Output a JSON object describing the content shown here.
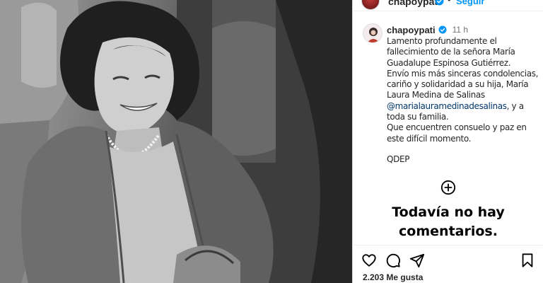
{
  "header": {
    "username": "chapoypati",
    "follow_label": "Seguir"
  },
  "post": {
    "username": "chapoypati",
    "verified": true,
    "time": "11 h",
    "caption": {
      "p1": "Lamento profundamente el fallecimiento de la señora María Guadalupe Espinosa Gutiérrez.",
      "p2_before": "Envío mis más sinceras condolencias, cariño y solidaridad a su hija, María Laura Medina de Salinas",
      "mention": "@marialauramedinadesalinas",
      "p2_after": ", y a toda su familia.",
      "p3": "Que encuentren consuelo y paz en este difícil momento.",
      "p4": "QDEP"
    }
  },
  "comments": {
    "empty_title_line1": "Todavía no hay",
    "empty_title_line2": "comentarios."
  },
  "actions": {
    "icons": [
      "heart-icon",
      "comment-icon",
      "share-icon",
      "bookmark-icon"
    ],
    "likes_text": "2.203 Me gusta"
  },
  "colors": {
    "link": "#0095f6",
    "mention": "#00376b",
    "verified": "#0095f6",
    "text": "#262626",
    "muted": "#737373"
  }
}
